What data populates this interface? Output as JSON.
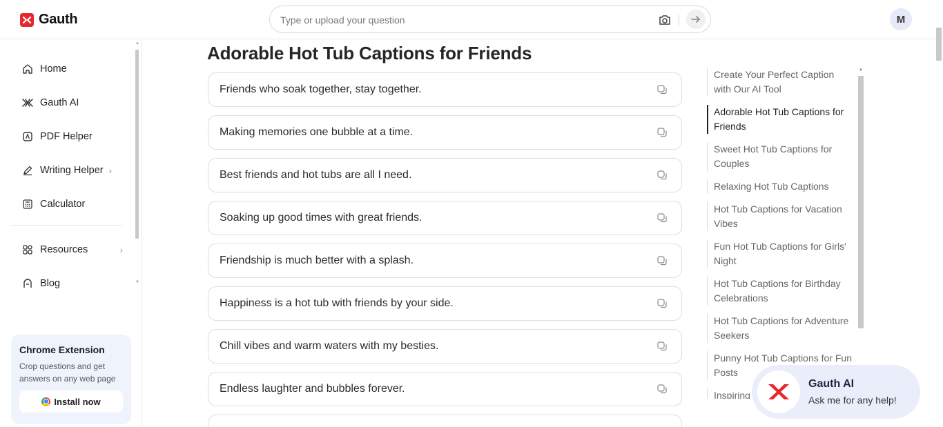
{
  "header": {
    "brand": "Gauth",
    "search_placeholder": "Type or upload your question",
    "avatar_initial": "M",
    "icons": {
      "camera": "camera-icon",
      "submit": "arrow-right-icon"
    }
  },
  "sidebar": {
    "items": [
      {
        "label": "Home",
        "icon": "home-icon"
      },
      {
        "label": "Gauth AI",
        "icon": "gauth-ai-icon"
      },
      {
        "label": "PDF Helper",
        "icon": "pdf-icon"
      },
      {
        "label": "Writing Helper",
        "icon": "pen-icon",
        "has_submenu": true
      },
      {
        "label": "Calculator",
        "icon": "calculator-icon"
      },
      {
        "label": "Resources",
        "icon": "grid-icon",
        "has_submenu": true
      },
      {
        "label": "Blog",
        "icon": "blog-icon"
      }
    ],
    "extension": {
      "title": "Chrome Extension",
      "description": "Crop questions and get answers on any web page",
      "button_label": "Install now"
    }
  },
  "main": {
    "section_title": "Adorable Hot Tub Captions for Friends",
    "captions": [
      "Friends who soak together, stay together.",
      "Making memories one bubble at a time.",
      "Best friends and hot tubs are all I need.",
      "Soaking up good times with great friends.",
      "Friendship is much better with a splash.",
      "Happiness is a hot tub with friends by your side.",
      "Chill vibes and warm waters with my besties.",
      "Endless laughter and bubbles forever."
    ]
  },
  "toc": {
    "active_index": 1,
    "items": [
      "Create Your Perfect Caption with Our AI Tool",
      "Adorable Hot Tub Captions for Friends",
      "Sweet Hot Tub Captions for Couples",
      "Relaxing Hot Tub Captions",
      "Hot Tub Captions for Vacation Vibes",
      "Fun Hot Tub Captions for Girls' Night",
      "Hot Tub Captions for Birthday Celebrations",
      "Hot Tub Captions for Adventure Seekers",
      "Punny Hot Tub Captions for Fun Posts",
      "Inspiring"
    ]
  },
  "ai_widget": {
    "title": "Gauth AI",
    "subtitle": "Ask me for any help!"
  },
  "colors": {
    "brand_red": "#e8262d",
    "widget_bg": "#eaeefb",
    "extension_bg": "#eff3fc"
  }
}
